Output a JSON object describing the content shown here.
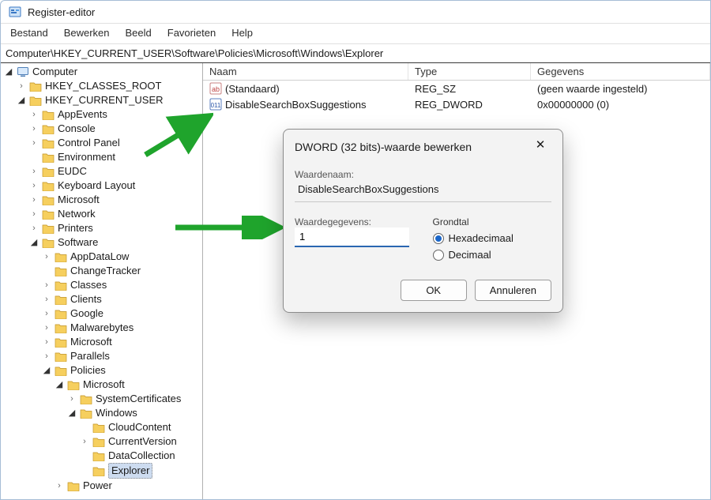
{
  "title": "Register-editor",
  "menu": [
    "Bestand",
    "Bewerken",
    "Beeld",
    "Favorieten",
    "Help"
  ],
  "address": "Computer\\HKEY_CURRENT_USER\\Software\\Policies\\Microsoft\\Windows\\Explorer",
  "tree": {
    "root": "Computer",
    "items": [
      {
        "label": "HKEY_CLASSES_ROOT",
        "depth": 1,
        "twisty": "closed"
      },
      {
        "label": "HKEY_CURRENT_USER",
        "depth": 1,
        "twisty": "open"
      },
      {
        "label": "AppEvents",
        "depth": 2,
        "twisty": "closed"
      },
      {
        "label": "Console",
        "depth": 2,
        "twisty": "closed"
      },
      {
        "label": "Control Panel",
        "depth": 2,
        "twisty": "closed"
      },
      {
        "label": "Environment",
        "depth": 2,
        "twisty": "none"
      },
      {
        "label": "EUDC",
        "depth": 2,
        "twisty": "closed"
      },
      {
        "label": "Keyboard Layout",
        "depth": 2,
        "twisty": "closed"
      },
      {
        "label": "Microsoft",
        "depth": 2,
        "twisty": "closed"
      },
      {
        "label": "Network",
        "depth": 2,
        "twisty": "closed"
      },
      {
        "label": "Printers",
        "depth": 2,
        "twisty": "closed"
      },
      {
        "label": "Software",
        "depth": 2,
        "twisty": "open"
      },
      {
        "label": "AppDataLow",
        "depth": 3,
        "twisty": "closed"
      },
      {
        "label": "ChangeTracker",
        "depth": 3,
        "twisty": "none"
      },
      {
        "label": "Classes",
        "depth": 3,
        "twisty": "closed"
      },
      {
        "label": "Clients",
        "depth": 3,
        "twisty": "closed"
      },
      {
        "label": "Google",
        "depth": 3,
        "twisty": "closed"
      },
      {
        "label": "Malwarebytes",
        "depth": 3,
        "twisty": "closed"
      },
      {
        "label": "Microsoft",
        "depth": 3,
        "twisty": "closed"
      },
      {
        "label": "Parallels",
        "depth": 3,
        "twisty": "closed"
      },
      {
        "label": "Policies",
        "depth": 3,
        "twisty": "open"
      },
      {
        "label": "Microsoft",
        "depth": 4,
        "twisty": "open"
      },
      {
        "label": "SystemCertificates",
        "depth": 5,
        "twisty": "closed"
      },
      {
        "label": "Windows",
        "depth": 5,
        "twisty": "open"
      },
      {
        "label": "CloudContent",
        "depth": 6,
        "twisty": "none"
      },
      {
        "label": "CurrentVersion",
        "depth": 6,
        "twisty": "closed"
      },
      {
        "label": "DataCollection",
        "depth": 6,
        "twisty": "none"
      },
      {
        "label": "Explorer",
        "depth": 6,
        "twisty": "none",
        "selected": true
      },
      {
        "label": "Power",
        "depth": 4,
        "twisty": "closed"
      }
    ]
  },
  "list": {
    "headers": {
      "name": "Naam",
      "type": "Type",
      "data": "Gegevens"
    },
    "rows": [
      {
        "icon": "string",
        "name": "(Standaard)",
        "type": "REG_SZ",
        "data": "(geen waarde ingesteld)"
      },
      {
        "icon": "binary",
        "name": "DisableSearchBoxSuggestions",
        "type": "REG_DWORD",
        "data": "0x00000000 (0)"
      }
    ]
  },
  "dialog": {
    "title": "DWORD (32 bits)-waarde bewerken",
    "valueNameLabel": "Waardenaam:",
    "valueName": "DisableSearchBoxSuggestions",
    "valueDataLabel": "Waardegegevens:",
    "valueData": "1",
    "baseLabel": "Grondtal",
    "radios": {
      "hex": "Hexadecimaal",
      "dec": "Decimaal"
    },
    "radioChecked": "hex",
    "ok": "OK",
    "cancel": "Annuleren"
  }
}
